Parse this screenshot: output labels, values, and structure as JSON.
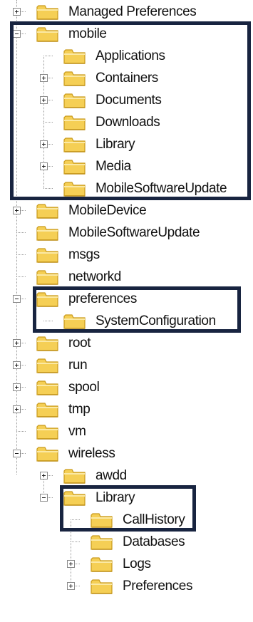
{
  "tree": {
    "items": [
      {
        "label": "Managed Preferences",
        "level": 0,
        "expander": "plus"
      },
      {
        "label": "mobile",
        "level": 0,
        "expander": "minus"
      },
      {
        "label": "Applications",
        "level": 1,
        "expander": "none"
      },
      {
        "label": "Containers",
        "level": 1,
        "expander": "plus"
      },
      {
        "label": "Documents",
        "level": 1,
        "expander": "plus"
      },
      {
        "label": "Downloads",
        "level": 1,
        "expander": "none"
      },
      {
        "label": "Library",
        "level": 1,
        "expander": "plus"
      },
      {
        "label": "Media",
        "level": 1,
        "expander": "plus"
      },
      {
        "label": "MobileSoftwareUpdate",
        "level": 1,
        "expander": "none"
      },
      {
        "label": "MobileDevice",
        "level": 0,
        "expander": "plus"
      },
      {
        "label": "MobileSoftwareUpdate",
        "level": 0,
        "expander": "none"
      },
      {
        "label": "msgs",
        "level": 0,
        "expander": "none"
      },
      {
        "label": "networkd",
        "level": 0,
        "expander": "none"
      },
      {
        "label": "preferences",
        "level": 0,
        "expander": "minus"
      },
      {
        "label": "SystemConfiguration",
        "level": 1,
        "expander": "none"
      },
      {
        "label": "root",
        "level": 0,
        "expander": "plus"
      },
      {
        "label": "run",
        "level": 0,
        "expander": "plus"
      },
      {
        "label": "spool",
        "level": 0,
        "expander": "plus"
      },
      {
        "label": "tmp",
        "level": 0,
        "expander": "plus"
      },
      {
        "label": "vm",
        "level": 0,
        "expander": "none"
      },
      {
        "label": "wireless",
        "level": 0,
        "expander": "minus"
      },
      {
        "label": "awdd",
        "level": 1,
        "expander": "plus"
      },
      {
        "label": "Library",
        "level": 1,
        "expander": "minus"
      },
      {
        "label": "CallHistory",
        "level": 2,
        "expander": "none"
      },
      {
        "label": "Databases",
        "level": 2,
        "expander": "none"
      },
      {
        "label": "Logs",
        "level": 2,
        "expander": "plus"
      },
      {
        "label": "Preferences",
        "level": 2,
        "expander": "plus"
      }
    ]
  },
  "highlights": [
    {
      "name": "highlight-mobile",
      "first": 1,
      "last": 8
    },
    {
      "name": "highlight-preferences",
      "first": 13,
      "last": 14
    },
    {
      "name": "highlight-library",
      "first": 22,
      "last": 23
    }
  ],
  "colors": {
    "folder_fill": "#f5cf55",
    "folder_edge": "#c99a1a",
    "highlight_border": "#182440"
  }
}
